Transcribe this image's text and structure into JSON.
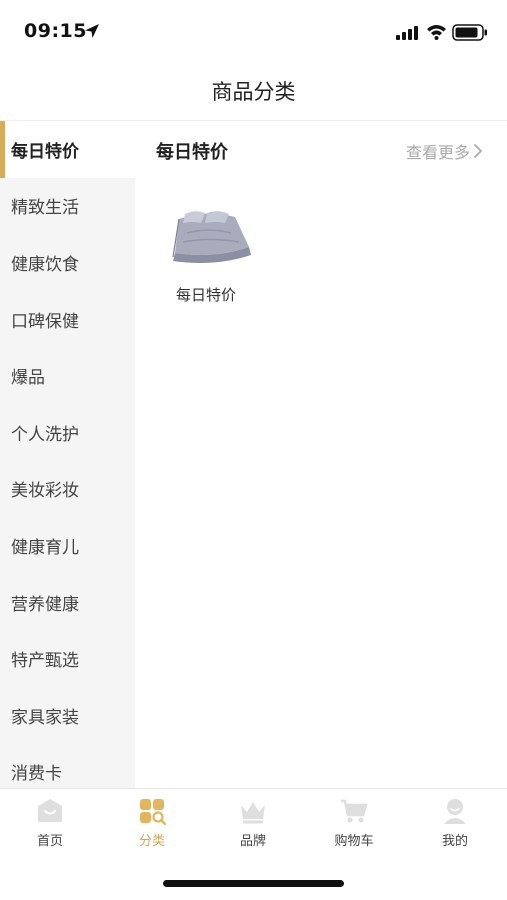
{
  "status_bar": {
    "time": "09:15"
  },
  "header": {
    "title": "商品分类"
  },
  "sidebar": {
    "items": [
      {
        "label": "每日特价",
        "active": true
      },
      {
        "label": "精致生活",
        "active": false
      },
      {
        "label": "健康饮食",
        "active": false
      },
      {
        "label": "口碑保健",
        "active": false
      },
      {
        "label": "爆品",
        "active": false
      },
      {
        "label": "个人洗护",
        "active": false
      },
      {
        "label": "美妆彩妆",
        "active": false
      },
      {
        "label": "健康育儿",
        "active": false
      },
      {
        "label": "营养健康",
        "active": false
      },
      {
        "label": "特产甄选",
        "active": false
      },
      {
        "label": "家具家装",
        "active": false
      },
      {
        "label": "消费卡",
        "active": false
      }
    ]
  },
  "section": {
    "title": "每日特价",
    "more_label": "查看更多",
    "products": [
      {
        "name": "每日特价",
        "icon": "bedding-product-image"
      }
    ]
  },
  "tabbar": {
    "tabs": [
      {
        "label": "首页",
        "icon": "home-icon",
        "active": false
      },
      {
        "label": "分类",
        "icon": "category-icon",
        "active": true
      },
      {
        "label": "品牌",
        "icon": "crown-icon",
        "active": false
      },
      {
        "label": "购物车",
        "icon": "cart-icon",
        "active": false
      },
      {
        "label": "我的",
        "icon": "profile-icon",
        "active": false
      }
    ]
  },
  "colors": {
    "accent": "#d8ab5a",
    "sidebar_bg": "#f5f5f5",
    "inactive_icon": "#d9d9d9"
  }
}
